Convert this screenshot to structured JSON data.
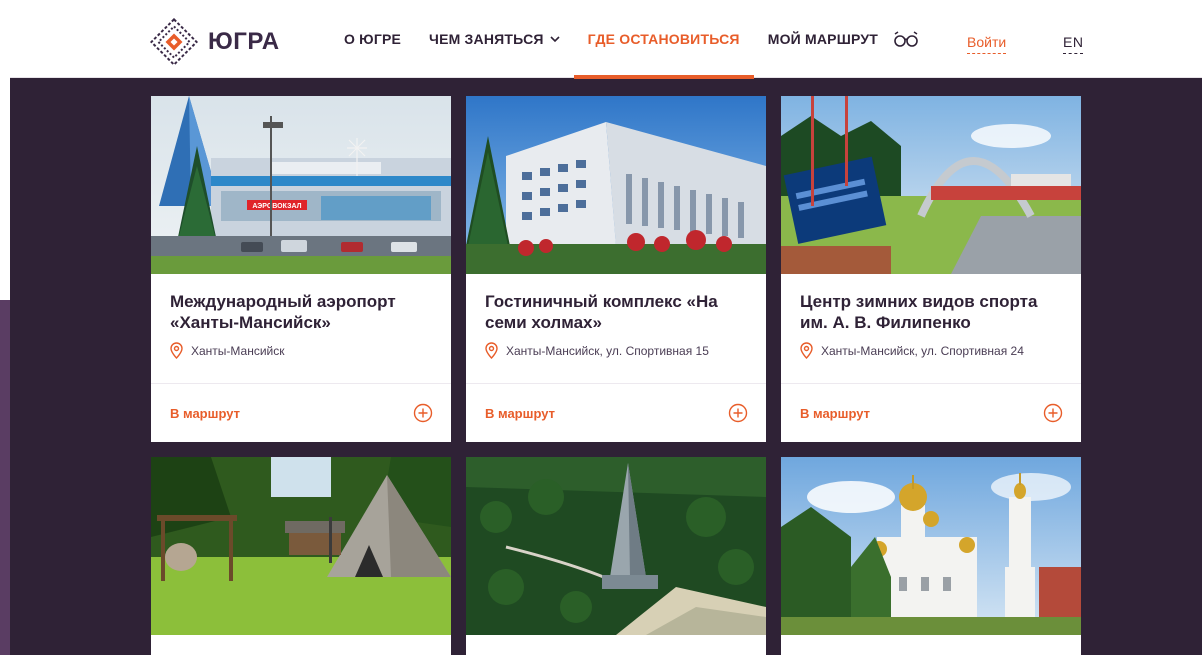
{
  "brand": {
    "name": "ЮГРА",
    "accent": "#e85d2a",
    "dark": "#2f2236"
  },
  "nav": {
    "items": [
      {
        "label": "О ЮГРЕ",
        "active": false
      },
      {
        "label": "ЧЕМ ЗАНЯТЬСЯ",
        "active": false,
        "has_dropdown": true
      },
      {
        "label": "ГДЕ ОСТАНОВИТЬСЯ",
        "active": true
      },
      {
        "label": "МОЙ МАРШРУТ",
        "active": false
      }
    ],
    "accessibility_icon": "glasses-icon",
    "login": "Войти",
    "lang": "EN"
  },
  "cards": [
    {
      "title": "Международный аэропорт «Ханты-Мансийск»",
      "location": "Ханты-Мансийск",
      "action": "В маршрут"
    },
    {
      "title": "Гостиничный комплекс «На семи холмах»",
      "location": "Ханты-Мансийск, ул. Спортивная 15",
      "action": "В маршрут"
    },
    {
      "title": "Центр зимних видов спорта им. А. В. Филипенко",
      "location": "Ханты-Мансийск, ул. Спортивная 24",
      "action": "В маршрут"
    },
    {
      "title": "",
      "location": "",
      "action": ""
    },
    {
      "title": "",
      "location": "",
      "action": ""
    },
    {
      "title": "",
      "location": "",
      "action": ""
    }
  ],
  "images": {
    "airport_sign": "АЭРОВОКЗАЛ"
  }
}
